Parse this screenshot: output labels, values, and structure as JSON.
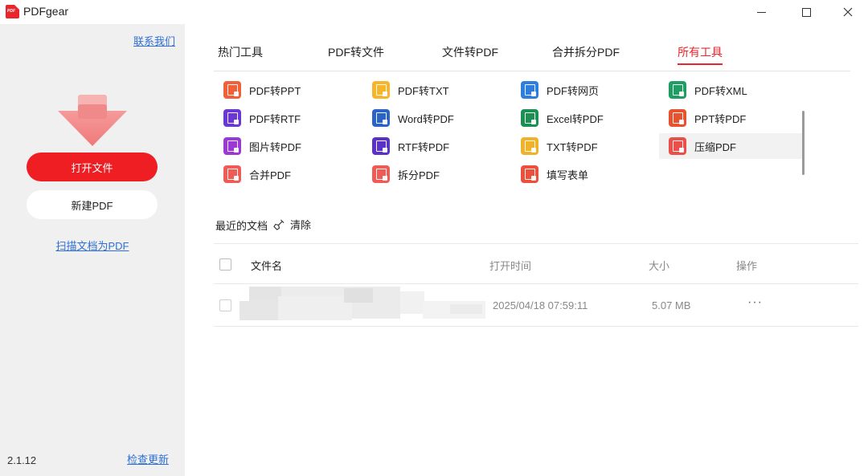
{
  "window": {
    "title": "PDFgear",
    "logo_text": "PDF"
  },
  "sidebar": {
    "contact_link": "联系我们",
    "open_file_button": "打开文件",
    "new_pdf_button": "新建PDF",
    "scan_link": "扫描文档为PDF",
    "version": "2.1.12",
    "update_link": "检查更新"
  },
  "tabs": [
    {
      "label": "热门工具",
      "active": false
    },
    {
      "label": "PDF转文件",
      "active": false
    },
    {
      "label": "文件转PDF",
      "active": false
    },
    {
      "label": "合并拆分PDF",
      "active": false
    },
    {
      "label": "所有工具",
      "active": true
    }
  ],
  "tools": [
    {
      "label": "PDF转PPT",
      "icon": "pdf-to-ppt-icon",
      "color": "#f0613a"
    },
    {
      "label": "PDF转TXT",
      "icon": "pdf-to-txt-icon",
      "color": "#f7b52c"
    },
    {
      "label": "PDF转网页",
      "icon": "pdf-to-web-icon",
      "color": "#2e7de0"
    },
    {
      "label": "PDF转XML",
      "icon": "pdf-to-xml-icon",
      "color": "#1f9e64"
    },
    {
      "label": "PDF转RTF",
      "icon": "pdf-to-rtf-icon",
      "color": "#6a37d6"
    },
    {
      "label": "Word转PDF",
      "icon": "word-to-pdf-icon",
      "color": "#2b64c9"
    },
    {
      "label": "Excel转PDF",
      "icon": "excel-to-pdf-icon",
      "color": "#1c8f52"
    },
    {
      "label": "PPT转PDF",
      "icon": "ppt-to-pdf-icon",
      "color": "#e8522e"
    },
    {
      "label": "图片转PDF",
      "icon": "image-to-pdf-icon",
      "color": "#9b38d6"
    },
    {
      "label": "RTF转PDF",
      "icon": "rtf-to-pdf-icon",
      "color": "#5a32c8"
    },
    {
      "label": "TXT转PDF",
      "icon": "txt-to-pdf-icon",
      "color": "#f0b229"
    },
    {
      "label": "压缩PDF",
      "icon": "compress-pdf-icon",
      "color": "#ec4f4a",
      "hovered": true
    },
    {
      "label": "合并PDF",
      "icon": "merge-pdf-icon",
      "color": "#ef5b55"
    },
    {
      "label": "拆分PDF",
      "icon": "split-pdf-icon",
      "color": "#ef5b55"
    },
    {
      "label": "填写表单",
      "icon": "fill-form-icon",
      "color": "#ec4f3c"
    }
  ],
  "recent": {
    "title": "最近的文档",
    "clear_label": "清除",
    "columns": {
      "name": "文件名",
      "open_time": "打开时间",
      "size": "大小",
      "actions": "操作"
    },
    "rows": [
      {
        "open_time": "2025/04/18 07:59:11",
        "size": "5.07 MB",
        "actions": "···"
      }
    ]
  },
  "colors": {
    "accent": "#e8262b",
    "link": "#2f6fd6",
    "sidebar_bg": "#f0f0f0"
  }
}
